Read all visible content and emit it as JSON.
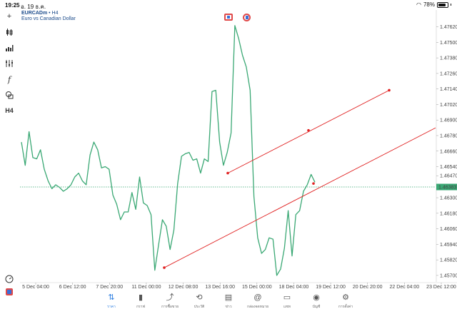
{
  "status": {
    "time": "19:25",
    "date": "อ. 19 ธ.ค.",
    "battery": "78%"
  },
  "symbol": {
    "name": "EURCADm",
    "timeframe": "H4",
    "description": "Euro vs Canadian Dollar",
    "current_price": "1.46383"
  },
  "colors": {
    "line": "#3aa874",
    "trendline": "#e02020",
    "bid_line": "#3aa874",
    "price_tag_bg": "#3aa874",
    "accent": "#2a7de1"
  },
  "toolbar_icons": [
    "crosshair-icon",
    "candles-icon",
    "volume-bars-icon",
    "indicators-icon",
    "function-icon",
    "objects-icon",
    "timeframe-icon",
    "gauge-icon",
    "trade-icon"
  ],
  "toolbar_labels": {
    "timeframe": "H4"
  },
  "chart_data": {
    "type": "line",
    "ylim": [
      1.4565,
      1.4775
    ],
    "y_ticks": [
      "1.47620",
      "1.47500",
      "1.47380",
      "1.47260",
      "1.47140",
      "1.47020",
      "1.46900",
      "1.46780",
      "1.46660",
      "1.46540",
      "1.46470",
      "1.46300",
      "1.46180",
      "1.46060",
      "1.45940",
      "1.45820",
      "1.45700"
    ],
    "x_ticks": [
      "5 Dec 04:00",
      "6 Dec 12:00",
      "7 Dec 20:00",
      "11 Dec 00:00",
      "12 Dec 08:00",
      "13 Dec 16:00",
      "15 Dec 00:00",
      "18 Dec 04:00",
      "19 Dec 12:00",
      "20 Dec 20:00",
      "22 Dec 04:00",
      "23 Dec 12:00"
    ],
    "series": [
      {
        "values": [
          1.4673,
          1.4655,
          1.4681,
          1.4661,
          1.466,
          1.4667,
          1.4652,
          1.4643,
          1.4637,
          1.464,
          1.4638,
          1.4635,
          1.4637,
          1.464,
          1.4646,
          1.4649,
          1.4643,
          1.464,
          1.4663,
          1.4673,
          1.4667,
          1.4653,
          1.4654,
          1.4652,
          1.4632,
          1.4625,
          1.4613,
          1.4619,
          1.4619,
          1.4634,
          1.4621,
          1.4646,
          1.4626,
          1.4624,
          1.4617,
          1.4574,
          1.4594,
          1.4613,
          1.4608,
          1.459,
          1.4605,
          1.4641,
          1.4662,
          1.4664,
          1.4665,
          1.4659,
          1.466,
          1.4649,
          1.466,
          1.4658,
          1.4712,
          1.4713,
          1.4673,
          1.4655,
          1.4665,
          1.468,
          1.4763,
          1.4753,
          1.474,
          1.4731,
          1.4713,
          1.4631,
          1.4599,
          1.4587,
          1.459,
          1.4599,
          1.4598,
          1.457,
          1.4575,
          1.4591,
          1.462,
          1.4585,
          1.4617,
          1.462,
          1.4635,
          1.464,
          1.4648,
          1.4642
        ]
      }
    ],
    "trendlines": [
      {
        "from": [
          "13 Dec 16:00",
          1.4649
        ],
        "mid": [
          "18 Dec 04:00",
          1.4682
        ],
        "to": [
          "20 Dec 20:00",
          1.4713
        ]
      },
      {
        "from": [
          "12 Dec 00:00",
          1.4576
        ],
        "mid": [
          "18 Dec 12:00",
          1.4641
        ],
        "to": [
          "23 Dec 12:00",
          1.4684
        ]
      }
    ]
  },
  "nav": [
    {
      "icon": "quotes-icon",
      "label": "ราคา",
      "active": true
    },
    {
      "icon": "chart-icon",
      "label": "กราฟ",
      "active": false
    },
    {
      "icon": "trade-icon",
      "label": "การซื้อขาย",
      "active": false
    },
    {
      "icon": "history-icon",
      "label": "ประวัติ",
      "active": false
    },
    {
      "icon": "news-icon",
      "label": "ข่าว",
      "active": false
    },
    {
      "icon": "mailbox-icon",
      "label": "กล่องจดหมาย",
      "active": false
    },
    {
      "icon": "chat-icon",
      "label": "แชท",
      "active": false
    },
    {
      "icon": "account-icon",
      "label": "บัญชี",
      "active": false
    },
    {
      "icon": "settings-icon",
      "label": "การตั้งค่า",
      "active": false
    }
  ]
}
